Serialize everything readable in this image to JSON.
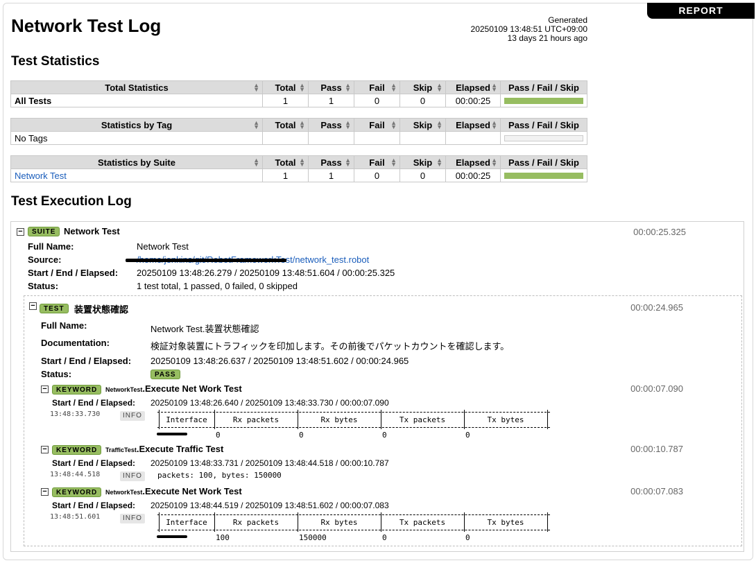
{
  "report_link": "REPORT",
  "title": "Network Test Log",
  "generated": {
    "label": "Generated",
    "timestamp": "20250109 13:48:51 UTC+09:00",
    "ago": "13 days 21 hours ago"
  },
  "statistics": {
    "title": "Test Statistics",
    "columns": [
      "Total",
      "Pass",
      "Fail",
      "Skip",
      "Elapsed",
      "Pass / Fail / Skip"
    ],
    "total": {
      "header": "Total Statistics",
      "row": {
        "name": "All Tests",
        "total": "1",
        "pass": "1",
        "fail": "0",
        "skip": "0",
        "elapsed": "00:00:25"
      },
      "pass_ratio": 1.0
    },
    "tag": {
      "header": "Statistics by Tag",
      "row": {
        "name": "No Tags",
        "total": "",
        "pass": "",
        "fail": "",
        "skip": "",
        "elapsed": ""
      },
      "pass_ratio": 0
    },
    "suite": {
      "header": "Statistics by Suite",
      "row": {
        "name": "Network Test",
        "total": "1",
        "pass": "1",
        "fail": "0",
        "skip": "0",
        "elapsed": "00:00:25"
      },
      "pass_ratio": 1.0
    }
  },
  "execution": {
    "title": "Test Execution Log",
    "suite": {
      "label": "SUITE",
      "name": "Network Test",
      "elapsed": "00:00:25.325",
      "full_name_key": "Full Name:",
      "full_name": "Network Test",
      "source_key": "Source:",
      "source": "/home/jenkins/git/RobotFrameworkTest/network_test.robot",
      "times_key": "Start / End / Elapsed:",
      "times": "20250109 13:48:26.279 / 20250109 13:48:51.604 / 00:00:25.325",
      "status_key": "Status:",
      "status": "1 test total, 1 passed, 0 failed, 0 skipped"
    },
    "test": {
      "label": "TEST",
      "name": "装置状態確認",
      "elapsed": "00:00:24.965",
      "full_name_key": "Full Name:",
      "full_name": "Network Test.装置状態確認",
      "doc_key": "Documentation:",
      "doc": "検証対象装置にトラフィックを印加します。その前後でパケットカウントを確認します。",
      "times_key": "Start / End / Elapsed:",
      "times": "20250109 13:48:26.637 / 20250109 13:48:51.602 / 00:00:24.965",
      "status_key": "Status:",
      "status": "PASS"
    },
    "keywords": [
      {
        "label": "KEYWORD",
        "lib": "NetworkTest",
        "name": "Execute Net Work Test",
        "elapsed": "00:00:07.090",
        "times_key": "Start / End / Elapsed:",
        "times": "20250109 13:48:26.640 / 20250109 13:48:33.730 / 00:00:07.090",
        "msg_time": "13:48:33.730",
        "level": "INFO",
        "table": {
          "headers": [
            "Interface",
            "Rx packets",
            "Rx bytes",
            "Tx packets",
            "Tx bytes"
          ],
          "row": [
            "",
            "0",
            "0",
            "0",
            "0"
          ]
        }
      },
      {
        "label": "KEYWORD",
        "lib": "TrafficTest",
        "name": "Execute Traffic Test",
        "elapsed": "00:00:10.787",
        "times_key": "Start / End / Elapsed:",
        "times": "20250109 13:48:33.731 / 20250109 13:48:44.518 / 00:00:10.787",
        "msg_time": "13:48:44.518",
        "level": "INFO",
        "message": "packets: 100, bytes: 150000"
      },
      {
        "label": "KEYWORD",
        "lib": "NetworkTest",
        "name": "Execute Net Work Test",
        "elapsed": "00:00:07.083",
        "times_key": "Start / End / Elapsed:",
        "times": "20250109 13:48:44.519 / 20250109 13:48:51.602 / 00:00:07.083",
        "msg_time": "13:48:51.601",
        "level": "INFO",
        "table": {
          "headers": [
            "Interface",
            "Rx packets",
            "Rx bytes",
            "Tx packets",
            "Tx bytes"
          ],
          "row": [
            "",
            "100",
            "150000",
            "0",
            "0"
          ]
        }
      }
    ]
  },
  "colors": {
    "pass": "#97bd61",
    "link": "#1a5dbb",
    "header_bg": "#dcdcdc"
  }
}
